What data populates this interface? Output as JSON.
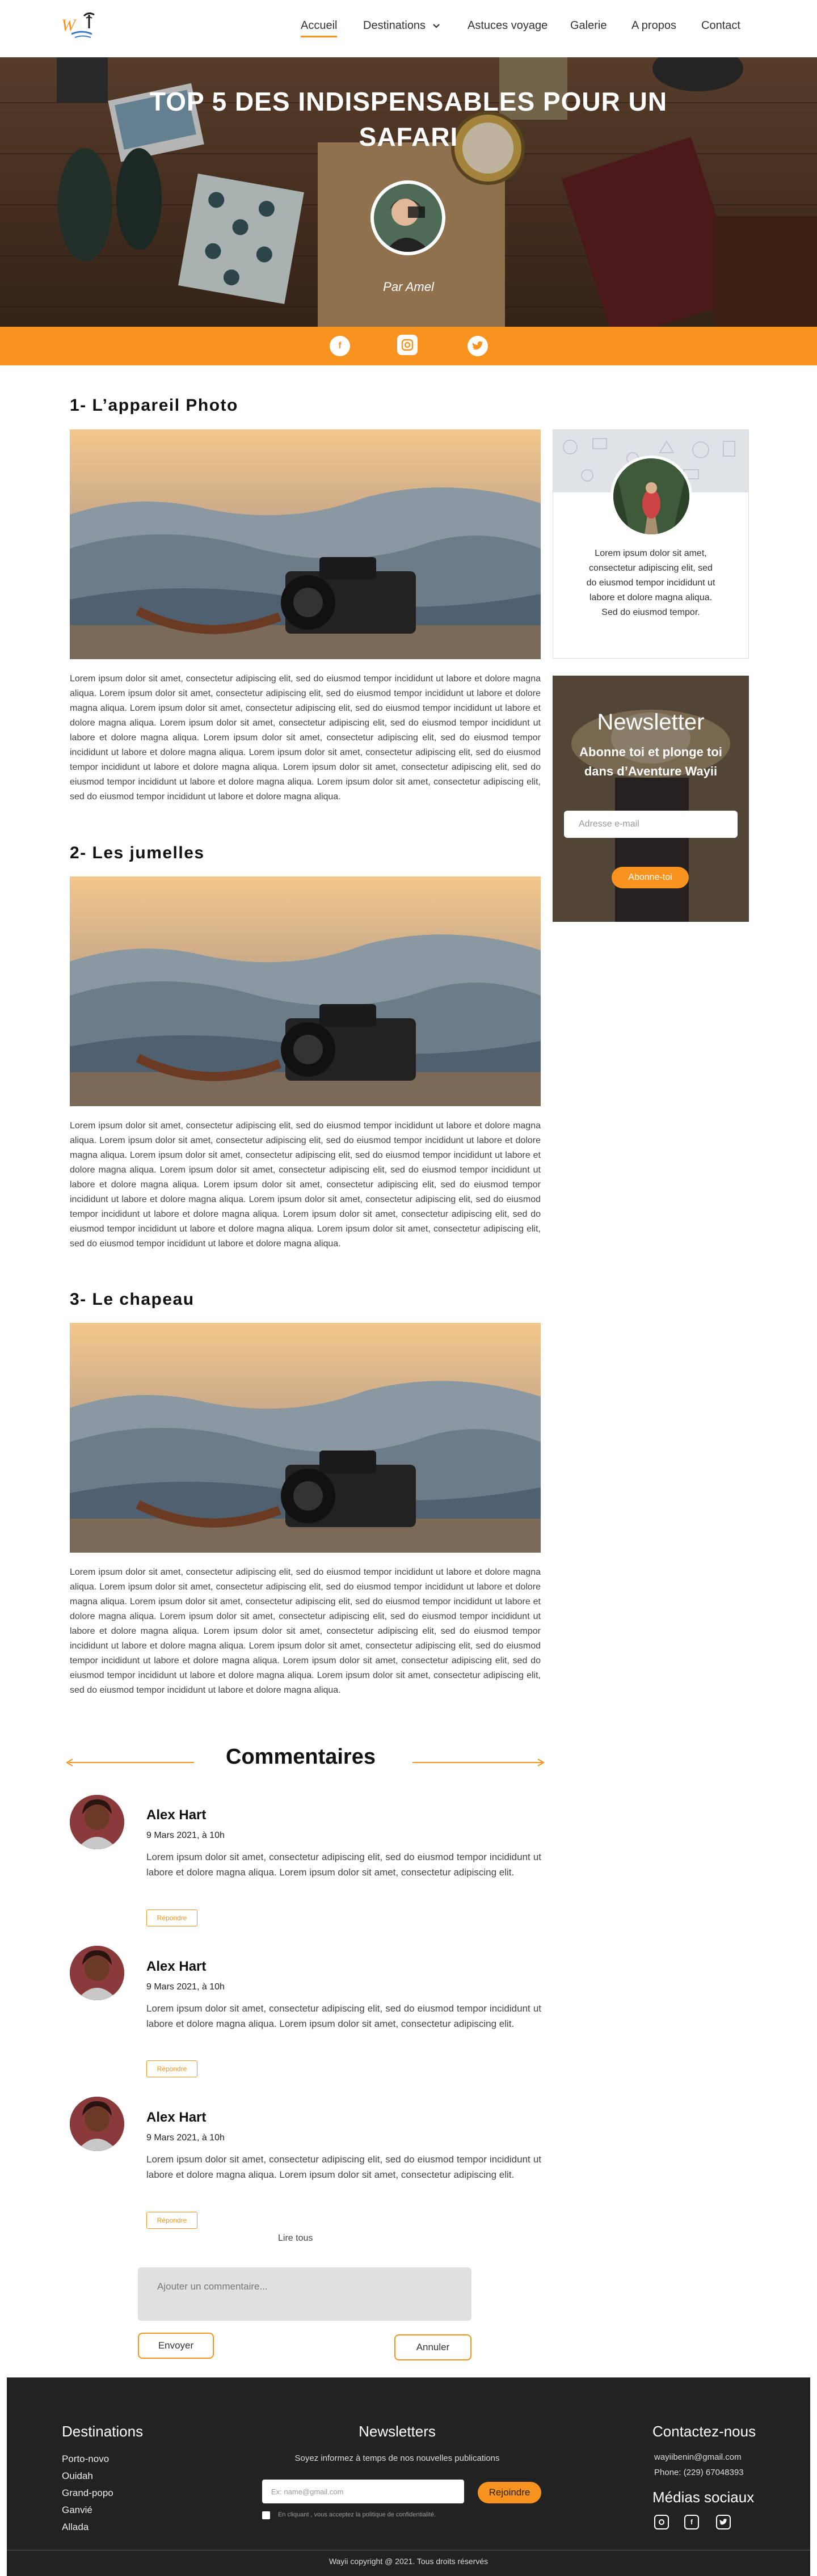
{
  "nav": {
    "items": [
      "Accueil",
      "Destinations",
      "Astuces voyage",
      "Galerie",
      "A propos",
      "Contact"
    ]
  },
  "hero": {
    "title": "TOP 5 DES INDISPENSABLES POUR UN SAFARI",
    "author": "Par Amel"
  },
  "social_icons": [
    "facebook-icon",
    "instagram-icon",
    "twitter-icon"
  ],
  "article": {
    "sections": [
      {
        "title": "1- L’appareil Photo"
      },
      {
        "title": "2- Les jumelles"
      },
      {
        "title": "3- Le chapeau"
      }
    ],
    "paragraph": "Lorem ipsum dolor sit amet, consectetur adipiscing elit, sed do eiusmod tempor incididunt ut labore et dolore magna aliqua. Lorem ipsum dolor sit amet, consectetur adipiscing elit, sed do eiusmod tempor incididunt ut labore et dolore magna aliqua. Lorem ipsum dolor sit amet, consectetur adipiscing elit, sed do eiusmod tempor incididunt ut labore et dolore magna aliqua. Lorem ipsum dolor sit amet, consectetur adipiscing elit, sed do eiusmod tempor incididunt ut labore et dolore magna aliqua. Lorem ipsum dolor sit amet, consectetur adipiscing elit, sed do eiusmod tempor incididunt ut labore et dolore magna aliqua. Lorem ipsum dolor sit amet, consectetur adipiscing elit, sed do eiusmod tempor incididunt ut labore et dolore magna aliqua. Lorem ipsum dolor sit amet, consectetur adipiscing elit, sed do eiusmod tempor incididunt ut labore et dolore magna aliqua. Lorem ipsum dolor sit amet, consectetur adipiscing elit, sed do eiusmod tempor incididunt ut labore et dolore magna aliqua."
  },
  "sidebar": {
    "profile_text": "Lorem ipsum dolor sit amet, consectetur adipiscing elit, sed do eiusmod tempor incididunt ut labore et dolore magna aliqua. Sed do eiusmod tempor.",
    "newsletter": {
      "title": "Newsletter",
      "subtitle": "Abonne toi et plonge toi dans d’Aventure Wayii",
      "placeholder": "Adresse e-mail",
      "button": "Abonne-toi"
    }
  },
  "comments": {
    "title": "Commentaires",
    "items": [
      {
        "name": "Alex Hart",
        "date": "9 Mars 2021, à 10h",
        "text": "Lorem ipsum dolor sit amet, consectetur adipiscing elit, sed do eiusmod tempor incididunt ut labore et dolore magna aliqua. Lorem ipsum dolor sit amet, consectetur adipiscing elit.",
        "reply": "Répondre"
      },
      {
        "name": "Alex Hart",
        "date": "9 Mars 2021, à 10h",
        "text": "Lorem ipsum dolor sit amet, consectetur adipiscing elit, sed do eiusmod tempor incididunt ut labore et dolore magna aliqua. Lorem ipsum dolor sit amet, consectetur adipiscing elit.",
        "reply": "Répondre"
      },
      {
        "name": "Alex Hart",
        "date": "9 Mars 2021, à 10h",
        "text": "Lorem ipsum dolor sit amet, consectetur adipiscing elit, sed do eiusmod tempor incididunt ut labore et dolore magna aliqua. Lorem ipsum dolor sit amet, consectetur adipiscing elit.",
        "reply": "Répondre"
      }
    ],
    "read_all": "Lire tous",
    "input_placeholder": "Ajouter un commentaire...",
    "send": "Envoyer",
    "cancel": "Annuler"
  },
  "footer": {
    "destinations_title": "Destinations",
    "destinations": [
      "Porto-novo",
      "Ouidah",
      "Grand-popo",
      "Ganvié",
      "Allada"
    ],
    "newsletter_title": "Newsletters",
    "newsletter_text": "Soyez informez à temps de nos nouvelles publications",
    "newsletter_placeholder": "Ex: name@gmail.com",
    "newsletter_button": "Rejoindre",
    "consent": "En cliquant , vous acceptez la politique de confidentialité.",
    "contact_title": "Contactez-nous",
    "email": "wayiibenin@gmail.com",
    "phone": "Phone: (229) 67048393",
    "social_title": "Médias sociaux",
    "copyright": "Wayii copyright @ 2021. Tous droits réservés"
  },
  "colors": {
    "accent": "#f7931e",
    "footer": "#222222"
  }
}
